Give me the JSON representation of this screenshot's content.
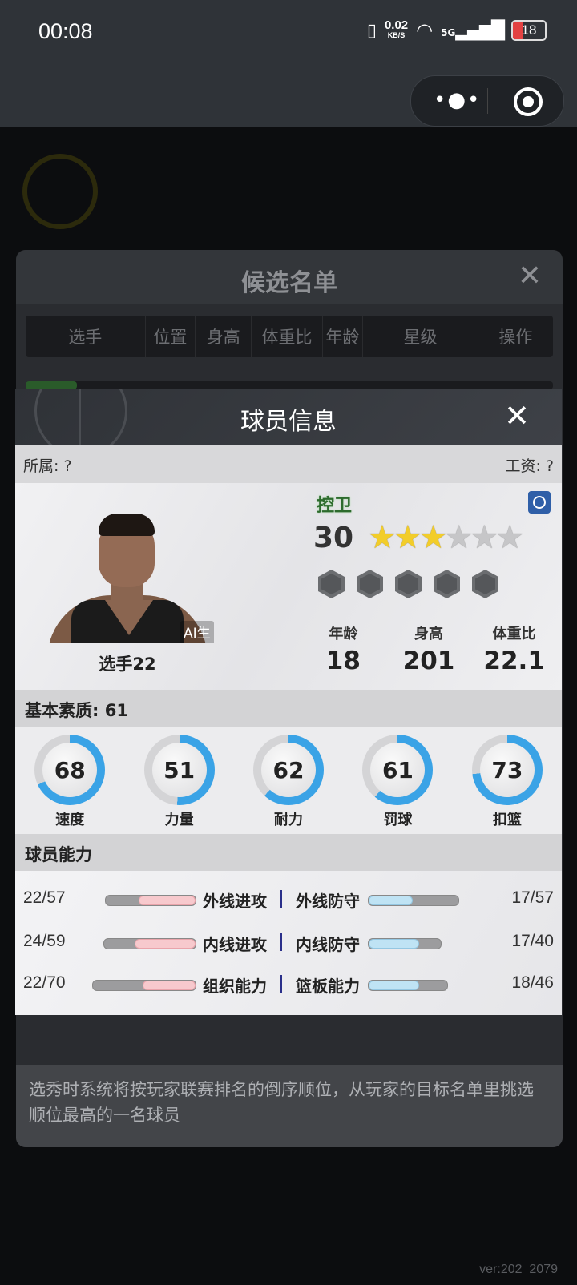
{
  "status_bar": {
    "time": "00:08",
    "speed_value": "0.02",
    "speed_unit": "KB/S",
    "net_type": "5G",
    "battery": "18"
  },
  "background_page": {
    "candidate_list": {
      "title": "候选名单",
      "columns": [
        "选手",
        "位置",
        "身高",
        "体重比",
        "年龄",
        "星级",
        "操作"
      ],
      "footer_text": "选秀时系统将按玩家联赛排名的倒序顺位，从玩家的目标名单里挑选顺位最高的一名球员"
    },
    "version": "ver:202_2079"
  },
  "modal": {
    "title": "球员信息",
    "affiliation": "所属: ?",
    "salary": "工资: ?",
    "player": {
      "name": "选手22",
      "ai_tag": "AI生成",
      "position": "控卫",
      "overall": "30",
      "star_rating": 3,
      "star_total": 6,
      "badge_count": 5,
      "attributes": [
        {
          "label": "年龄",
          "value": "18"
        },
        {
          "label": "身高",
          "value": "201"
        },
        {
          "label": "体重比",
          "value": "22.1"
        }
      ]
    },
    "basic_qualities": {
      "title": "基本素质: 61",
      "items": [
        {
          "label": "速度",
          "value": "68",
          "fraction": 0.68
        },
        {
          "label": "力量",
          "value": "51",
          "fraction": 0.51
        },
        {
          "label": "耐力",
          "value": "62",
          "fraction": 0.62
        },
        {
          "label": "罚球",
          "value": "61",
          "fraction": 0.61
        },
        {
          "label": "扣篮",
          "value": "73",
          "fraction": 0.73
        }
      ],
      "ring_color": "#3aa3e6"
    },
    "abilities": {
      "title": "球员能力",
      "rows": [
        {
          "left_name": "外线进攻",
          "left_value": "22/57",
          "left_fraction": 0.386,
          "right_name": "外线防守",
          "right_value": "17/57",
          "right_fraction": 0.298
        },
        {
          "left_name": "内线进攻",
          "left_value": "24/59",
          "left_fraction": 0.407,
          "right_name": "内线防守",
          "right_value": "17/40",
          "right_fraction": 0.425
        },
        {
          "left_name": "组织能力",
          "left_value": "22/70",
          "left_fraction": 0.314,
          "right_name": "篮板能力",
          "right_value": "18/46",
          "right_fraction": 0.391
        }
      ]
    }
  }
}
